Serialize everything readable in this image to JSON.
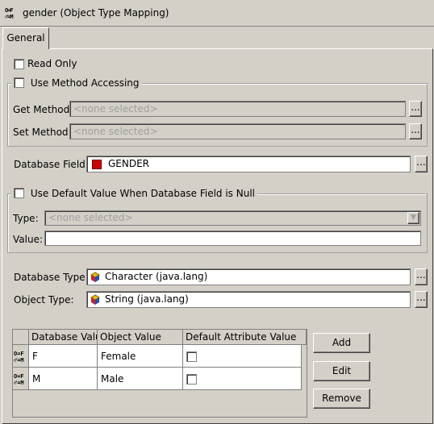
{
  "window": {
    "title": "gender (Object Type Mapping)"
  },
  "tabs": [
    {
      "label": "General"
    }
  ],
  "read_only": {
    "label": "Read Only",
    "checked": false
  },
  "method_accessing": {
    "label": "Use Method Accessing",
    "checked": false,
    "get_label": "Get Method:",
    "get_value": "<none selected>",
    "set_label": "Set Method:",
    "set_value": "<none selected>"
  },
  "database_field": {
    "label": "Database Field:",
    "value": "GENDER"
  },
  "default_value": {
    "label": "Use Default Value When Database Field is Null",
    "checked": false,
    "type_label": "Type:",
    "type_value": "<none selected>",
    "value_label": "Value:",
    "value": ""
  },
  "database_type": {
    "label": "Database Type:",
    "value": "Character (java.lang)"
  },
  "object_type": {
    "label": "Object Type:",
    "value": "String (java.lang)"
  },
  "ellipsis": "...",
  "table": {
    "columns": [
      "Database Value",
      "Object Value",
      "Default Attribute Value"
    ],
    "rows": [
      {
        "database_value": "F",
        "object_value": "Female",
        "default": false
      },
      {
        "database_value": "M",
        "object_value": "Male",
        "default": false
      }
    ]
  },
  "buttons": {
    "add": "Add",
    "edit": "Edit",
    "remove": "Remove"
  }
}
